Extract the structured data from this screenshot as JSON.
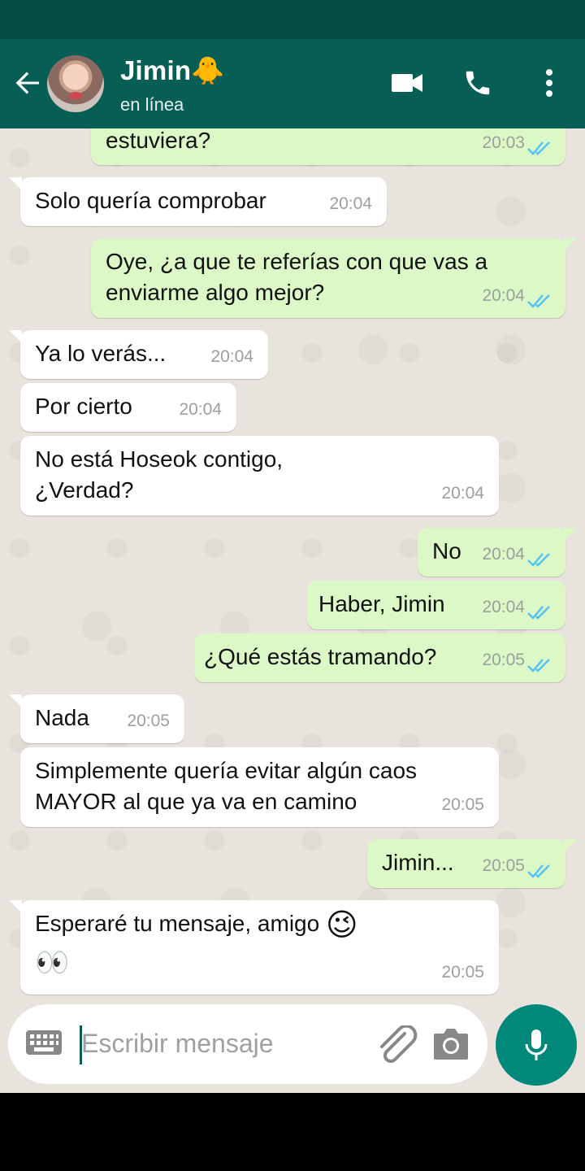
{
  "header": {
    "contact_name": "Jimin🐥",
    "contact_status": "en línea",
    "back_icon": "arrow-left-icon",
    "video_icon": "video-camera-icon",
    "call_icon": "phone-icon",
    "more_icon": "more-vert-icon"
  },
  "colors": {
    "header": "#075e54",
    "status_bar": "#054d44",
    "outgoing_bubble": "#dcf8c6",
    "incoming_bubble": "#ffffff",
    "read_ticks": "#4fc3f7",
    "mic_button": "#00897b"
  },
  "messages": [
    {
      "direction": "out",
      "text": "estuviera?",
      "time": "20:03",
      "read": true
    },
    {
      "direction": "in",
      "text": "Solo quería comprobar",
      "time": "20:04"
    },
    {
      "direction": "out",
      "text": "Oye, ¿a que te referías con que vas a",
      "text2": "enviarme algo mejor?",
      "time": "20:04",
      "read": true
    },
    {
      "direction": "in",
      "text": "Ya lo verás...",
      "time": "20:04"
    },
    {
      "direction": "in",
      "text": "Por cierto",
      "time": "20:04"
    },
    {
      "direction": "in",
      "text": "No está Hoseok contigo,",
      "text2": "¿Verdad?",
      "time": "20:04"
    },
    {
      "direction": "out",
      "text": "No",
      "time": "20:04",
      "read": true
    },
    {
      "direction": "out",
      "text": "Haber, Jimin",
      "time": "20:04",
      "read": true
    },
    {
      "direction": "out",
      "text": "¿Qué estás tramando?",
      "time": "20:05",
      "read": true
    },
    {
      "direction": "in",
      "text": "Nada",
      "time": "20:05"
    },
    {
      "direction": "in",
      "text": "Simplemente quería evitar algún caos",
      "text2": "MAYOR al que ya va en camino",
      "time": "20:05"
    },
    {
      "direction": "out",
      "text": "Jimin...",
      "time": "20:05",
      "read": true
    },
    {
      "direction": "in",
      "text": "Esperaré tu mensaje, amigo",
      "text2": "👀",
      "emoji": "😉",
      "time": "20:05"
    }
  ],
  "composer": {
    "placeholder": "Escribir mensaje",
    "keyboard_icon": "keyboard-icon",
    "attach_icon": "paperclip-icon",
    "camera_icon": "camera-icon",
    "mic_icon": "microphone-icon"
  }
}
